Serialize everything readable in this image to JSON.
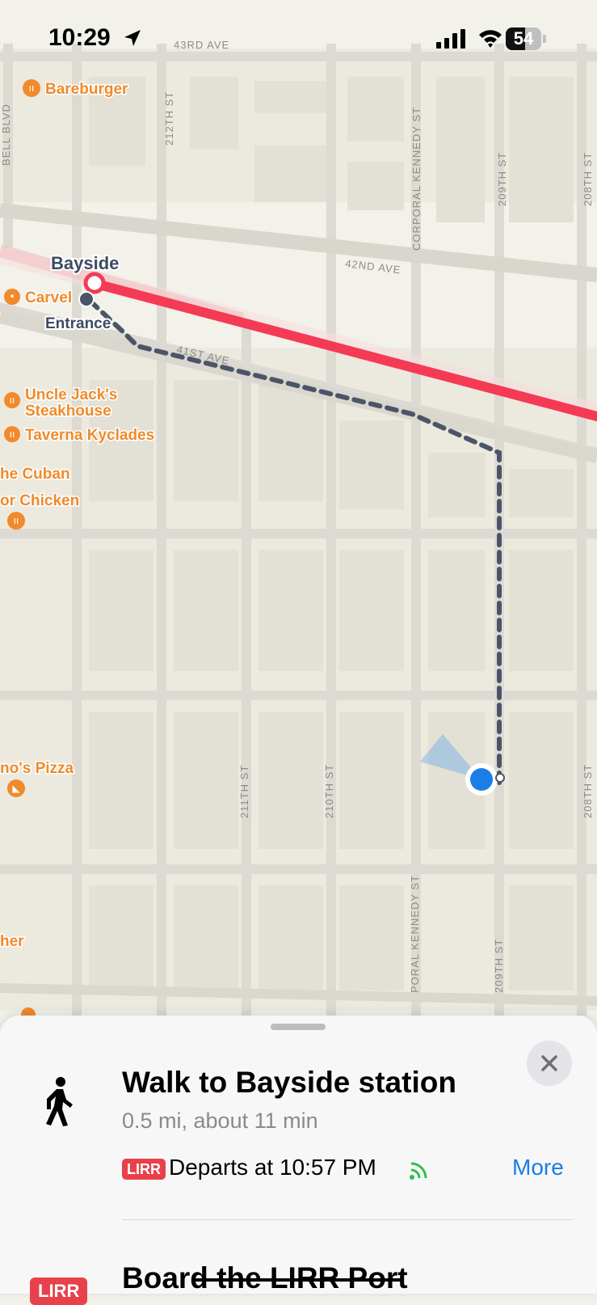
{
  "status_bar": {
    "time": "10:29",
    "battery_level": "54",
    "battery_fraction": 0.54
  },
  "map": {
    "street_labels": {
      "43rd_ave": "43RD AVE",
      "212th_st": "212TH ST",
      "corporal_kennedy_top": "CORPORAL KENNEDY ST",
      "209th_st_top": "209TH ST",
      "208th_st_top": "208TH ST",
      "bell_blvd": "BELL BLVD",
      "42nd_ave": "42ND AVE",
      "41st_ave": "41ST AVE",
      "211th_st": "211TH ST",
      "210th_st": "210TH ST",
      "208th_st_bottom": "208TH ST",
      "corporal_kennedy_bottom": "PORAL KENNEDY ST",
      "209th_st_bottom": "209TH ST"
    },
    "station_name": "Bayside",
    "entrance_label": "Entrance",
    "pois": {
      "bareburger": "Bareburger",
      "carvel": "Carvel",
      "uncle_jacks_line1": "Uncle Jack's",
      "uncle_jacks_line2": "Steakhouse",
      "taverna": "Taverna Kyclades",
      "cuban": "he Cuban",
      "chicken": "or Chicken",
      "pizza": "no's Pizza",
      "partial_bottom": "her"
    },
    "colors": {
      "route_rail": "#f43a55",
      "walk_path": "#4a5568",
      "user_location": "#1a7ee6",
      "poi": "#f08a2a"
    }
  },
  "sheet": {
    "step1": {
      "icon": "walking-person-icon",
      "title": "Walk to Bayside station",
      "subtitle": "0.5 mi, about 11 min",
      "badge": "LIRR",
      "departs": "Departs at 10:57 PM",
      "more": "More"
    },
    "step2": {
      "badge": "LIRR",
      "title": "Board the LIRR Port"
    },
    "close_icon": "close-icon"
  }
}
